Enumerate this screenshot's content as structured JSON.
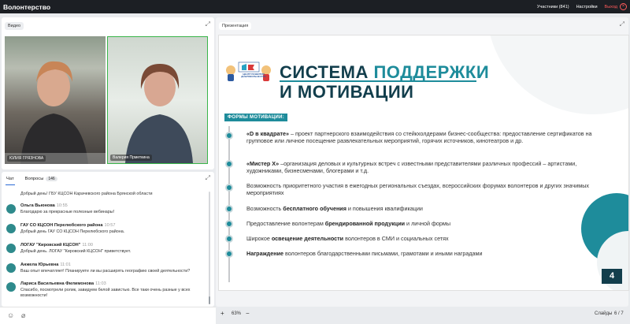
{
  "header": {
    "title": "Волонтерство",
    "participants": "Участники (841)",
    "settings": "Настройки",
    "exit": "Выход"
  },
  "video": {
    "tab": "Видео",
    "tiles": [
      {
        "name": "ЮЛИЯ ГРЯЗНОВА"
      },
      {
        "name": "Валерия Прметкина"
      }
    ]
  },
  "chat": {
    "tab_chat": "Чат",
    "tab_questions": "Вопросы",
    "questions_count": "146",
    "top_partial": "Добрый день! ГБУ КЦСОН Карачевского района Брянской области",
    "messages": [
      {
        "author": "Ольга Вьюнова",
        "time": "10:55",
        "text": "Благодарю за прекрасные полезные вебинары!"
      },
      {
        "author": "ГАУ СО КЦСОН Перелюбского района",
        "time": "10:57",
        "text": "Добрый день ГАУ СО КЦСОН Перелюбского района."
      },
      {
        "author": "ЛОГАУ \"Кировский КЦСОН\"",
        "time": "11:00",
        "text": "Добрый день. ЛОГАУ \"Кировский КЦСОН\" приветствует."
      },
      {
        "author": "Анжела Юрьевна",
        "time": "11:01",
        "text": "Ваш опыт впечатляет! Планируете ли вы расширять географию своей деятельности?"
      },
      {
        "author": "Лариса Васильевна Филимонова",
        "time": "11:03",
        "text": "Спасибо, посмотрели ролик, завидуем белой завистью. Все таки очень разные у всех возможности!"
      }
    ]
  },
  "presentation": {
    "tab": "Презентация",
    "logo_text": "ЦЕНТР РАЗВИТИЯ ДОБРОВОЛЬЧЕСТВА",
    "slide": {
      "title_part1": "СИСТЕМА ",
      "title_part2": "ПОДДЕРЖКИ",
      "title_line2": "И МОТИВАЦИИ",
      "forms_label": "ФОРМЫ МОТИВАЦИИ:",
      "page_number": "4",
      "items": [
        {
          "bold": "«D в квадрате»",
          "text": " – проект партнерского взаимодействия со стейкхолдерами бизнес-сообщества: предоставление сертификатов на групповое или личное посещение развлекательных мероприятий, горячих источников, кинотеатров и др."
        },
        {
          "bold": "«Мистер Х»",
          "text": " –организация деловых и культурных встреч с известными представителями различных профессий – артистами, художниками, бизнесменами, блогерами и т.д."
        },
        {
          "bold": "",
          "text": "Возможность приоритетного участия в ежегодных региональных съездах, всероссийских форумах волонтеров и других значимых мероприятиях"
        },
        {
          "pre": "Возможность ",
          "bold": "бесплатного обучения",
          "text": " и повышения квалификации"
        },
        {
          "pre": "Предоставление волонтерам ",
          "bold": "брендированной продукции",
          "text": " и  личной формы"
        },
        {
          "pre": "Широкое ",
          "bold": "освещение деятельности",
          "text": " волонтеров в СМИ и социальных сетях"
        },
        {
          "bold": "Награждение",
          "text": " волонтеров благодарственными письмами, грамотами и иными наградами"
        }
      ]
    },
    "zoom": "63%",
    "slides_label": "Слайды",
    "slides_counter": "6 / 7"
  }
}
